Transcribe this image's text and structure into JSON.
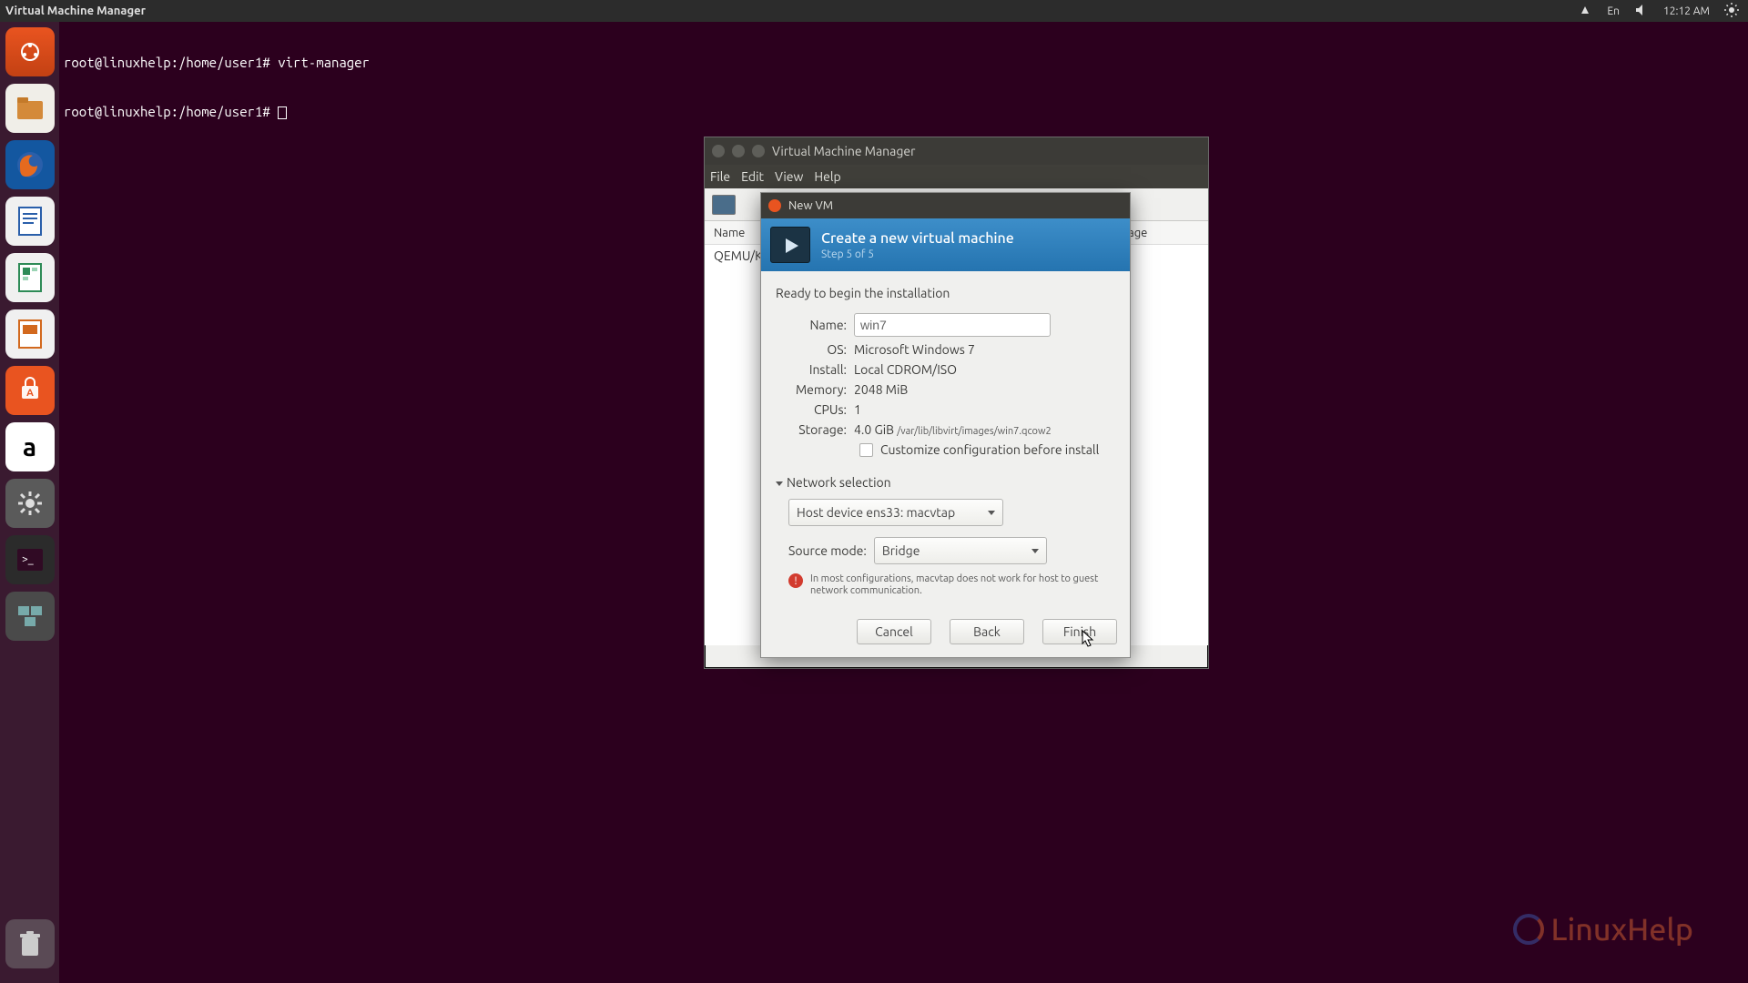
{
  "top_panel": {
    "title": "Virtual Machine Manager",
    "lang": "En",
    "clock": "12:12 AM"
  },
  "terminal": {
    "line1": "root@linuxhelp:/home/user1# virt-manager",
    "line2": "root@linuxhelp:/home/user1# "
  },
  "launcher": {
    "items": [
      {
        "name": "dash",
        "label": "Dash"
      },
      {
        "name": "files",
        "label": "Files"
      },
      {
        "name": "firefox",
        "label": "Firefox"
      },
      {
        "name": "writer",
        "label": "Writer"
      },
      {
        "name": "calc",
        "label": "Calc"
      },
      {
        "name": "impress",
        "label": "Impress"
      },
      {
        "name": "software",
        "label": "Software"
      },
      {
        "name": "amazon",
        "label": "Amazon"
      },
      {
        "name": "settings",
        "label": "Settings"
      },
      {
        "name": "terminal",
        "label": "Terminal"
      },
      {
        "name": "virtmanager",
        "label": "Virtual Machine Manager"
      }
    ]
  },
  "vmm": {
    "title": "Virtual Machine Manager",
    "menu": {
      "file": "File",
      "edit": "Edit",
      "view": "View",
      "help": "Help"
    },
    "headers": {
      "name": "Name",
      "cpu": "CPU usage"
    },
    "rows": [
      {
        "name": "QEMU/KVM"
      }
    ]
  },
  "dialog": {
    "title": "New VM",
    "banner": {
      "heading": "Create a new virtual machine",
      "step": "Step 5 of 5"
    },
    "ready": "Ready to begin the installation",
    "fields": {
      "name_label": "Name:",
      "name_value": "win7",
      "os_label": "OS:",
      "os_value": "Microsoft Windows 7",
      "install_label": "Install:",
      "install_value": "Local CDROM/ISO",
      "memory_label": "Memory:",
      "memory_value": "2048 MiB",
      "cpus_label": "CPUs:",
      "cpus_value": "1",
      "storage_label": "Storage:",
      "storage_value": "4.0 GiB",
      "storage_path": "/var/lib/libvirt/images/win7.qcow2",
      "customize_label": "Customize configuration before install"
    },
    "network": {
      "section_label": "Network selection",
      "device": "Host device ens33: macvtap",
      "source_mode_label": "Source mode:",
      "source_mode_value": "Bridge",
      "warning": "In most configurations, macvtap does not work for host to guest network communication."
    },
    "buttons": {
      "cancel": "Cancel",
      "back": "Back",
      "finish": "Finish"
    }
  },
  "watermark": "LinuxHelp"
}
